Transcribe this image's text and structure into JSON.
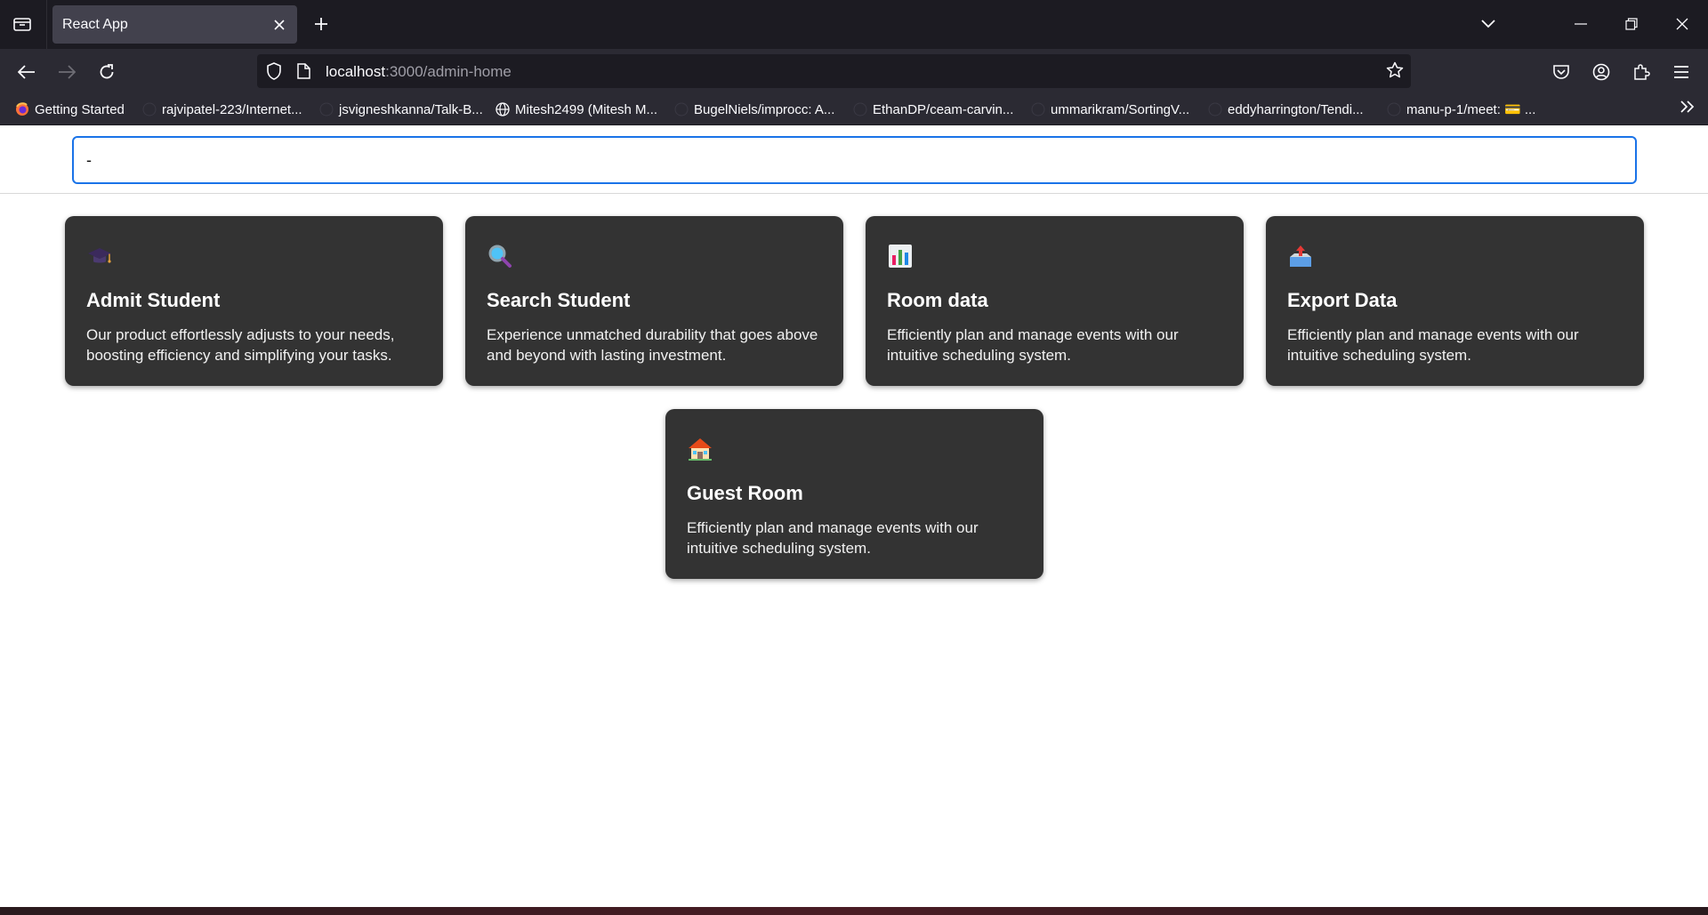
{
  "browser": {
    "tab_title": "React App",
    "url_host": "localhost",
    "url_path": ":3000/admin-home",
    "bookmarks": [
      {
        "label": "Getting Started",
        "icon": "firefox-icon"
      },
      {
        "label": "rajvipatel-223/Internet...",
        "icon": "github-icon"
      },
      {
        "label": "jsvigneshkanna/Talk-B...",
        "icon": "github-icon"
      },
      {
        "label": "Mitesh2499 (Mitesh M...",
        "icon": "globe-icon"
      },
      {
        "label": "BugelNiels/improcc: A...",
        "icon": "github-icon"
      },
      {
        "label": "EthanDP/ceam-carvin...",
        "icon": "github-icon"
      },
      {
        "label": "ummarikram/SortingV...",
        "icon": "github-icon"
      },
      {
        "label": "eddyharrington/Tendi...",
        "icon": "github-icon"
      },
      {
        "label": "manu-p-1/meet: 💳 ...",
        "icon": "github-icon"
      }
    ]
  },
  "search": {
    "value": "-",
    "placeholder": ""
  },
  "cards": [
    {
      "icon": "graduation-cap-icon",
      "title": "Admit Student",
      "description": "Our product effortlessly adjusts to your needs, boosting efficiency and simplifying your tasks."
    },
    {
      "icon": "magnifier-icon",
      "title": "Search Student",
      "description": "Experience unmatched durability that goes above and beyond with lasting investment."
    },
    {
      "icon": "bar-chart-icon",
      "title": "Room data",
      "description": "Efficiently plan and manage events with our intuitive scheduling system."
    },
    {
      "icon": "outbox-tray-icon",
      "title": "Export Data",
      "description": "Efficiently plan and manage events with our intuitive scheduling system."
    },
    {
      "icon": "house-icon",
      "title": "Guest Room",
      "description": "Efficiently plan and manage events with our intuitive scheduling system."
    }
  ],
  "colors": {
    "card_bg": "#333333",
    "input_border": "#1a73e8",
    "chrome_dark": "#1c1b22",
    "chrome_mid": "#2b2a33"
  }
}
